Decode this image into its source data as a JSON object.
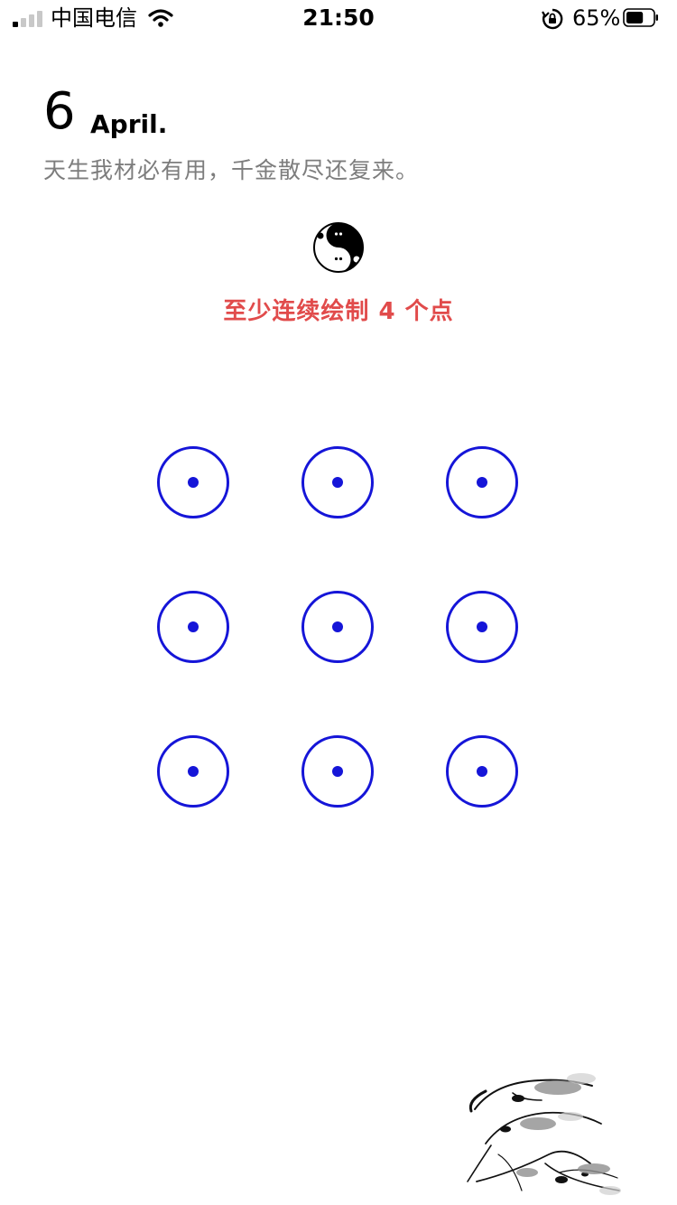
{
  "status_bar": {
    "carrier": "中国电信",
    "time": "21:50",
    "battery_percent": "65%",
    "signal_bars_on": 1,
    "signal_bars_total": 4,
    "battery_level": 0.65
  },
  "header": {
    "day": "6",
    "month": "April.",
    "quote": "天生我材必有用，千金散尽还复来。"
  },
  "avatar": {
    "icon": "panda-yin-yang-icon"
  },
  "hint": {
    "text": "至少连续绘制 4 个点",
    "color": "#e14b4b"
  },
  "pattern": {
    "rows": 3,
    "cols": 3,
    "accent_color": "#1515d8",
    "dots": [
      1,
      2,
      3,
      4,
      5,
      6,
      7,
      8,
      9
    ]
  },
  "decoration": {
    "icon": "ink-shrimp-painting"
  }
}
